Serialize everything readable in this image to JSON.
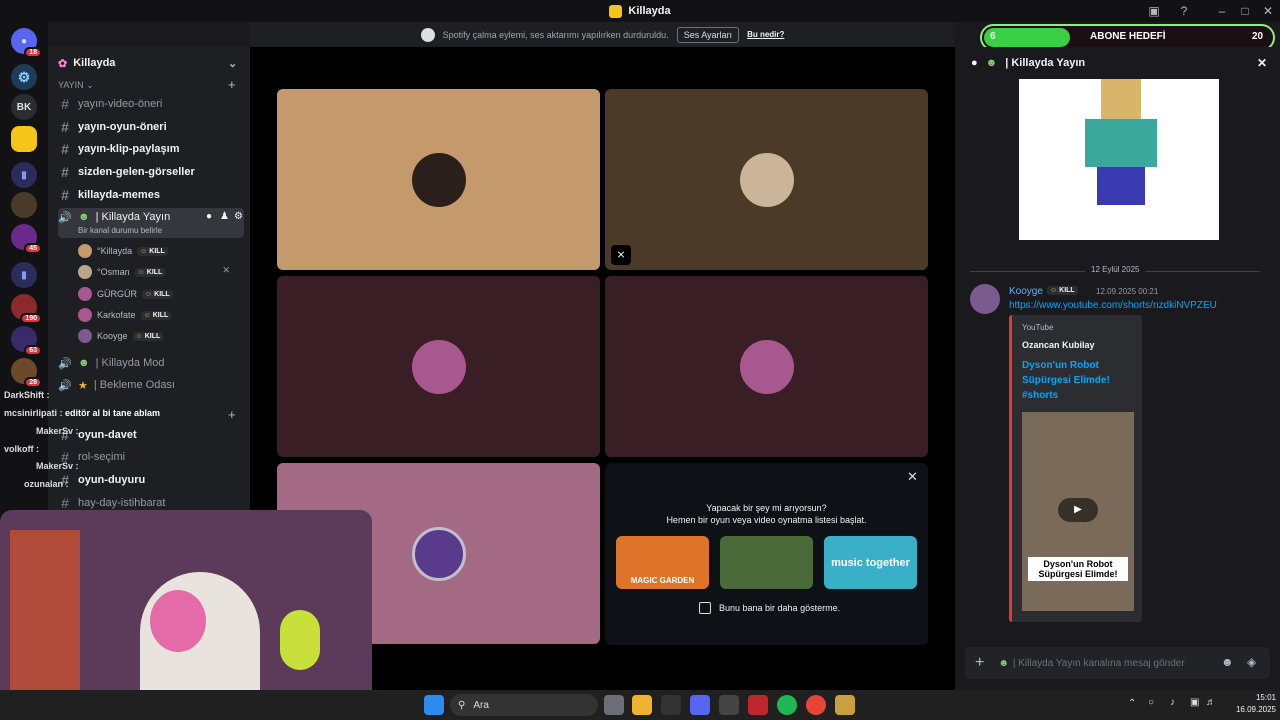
{
  "window": {
    "title": "Killayda"
  },
  "notice": {
    "text": "Spotify çalma eylemi, ses aktarımı yapılırken durduruldu.",
    "button": "Ses Ayarları",
    "link": "Bu nedir?"
  },
  "subgoal": {
    "current": "6",
    "label": "ABONE HEDEFİ",
    "target": "20",
    "progress_fraction": 0.3
  },
  "rail": {
    "servers": [
      {
        "icon": "discord-icon",
        "badge": "18"
      },
      {
        "icon": "gear-icon",
        "badge": ""
      },
      {
        "icon": "text",
        "label": "BK",
        "badge": ""
      },
      {
        "icon": "killayda-server-icon",
        "badge": ""
      },
      {
        "icon": "folder-icon",
        "badge": ""
      },
      {
        "icon": "server-avatar",
        "badge": ""
      },
      {
        "icon": "server-avatar",
        "badge": "45"
      },
      {
        "icon": "folder-icon",
        "badge": ""
      },
      {
        "icon": "server-avatar",
        "badge": "190"
      },
      {
        "icon": "server-avatar",
        "badge": "63"
      },
      {
        "icon": "server-avatar",
        "badge": "28"
      }
    ]
  },
  "server": {
    "name": "Killayda"
  },
  "channels": {
    "category": "YAYIN",
    "text": [
      {
        "name": "yayın-video-öneri",
        "bold": false
      },
      {
        "name": "yayın-oyun-öneri",
        "bold": true
      },
      {
        "name": "yayın-klip-paylaşım",
        "bold": true
      },
      {
        "name": "sizden-gelen-görseller",
        "bold": true
      },
      {
        "name": "killayda-memes",
        "bold": true
      }
    ],
    "voice_active": {
      "name": "| Killayda Yayın",
      "status": "Bir kanal durumu belirle"
    },
    "voice_users": [
      {
        "name": "°Killayda",
        "tag": "KILL"
      },
      {
        "name": "°Osman",
        "tag": "KILL"
      },
      {
        "name": "GÜRGÜR",
        "tag": "KILL"
      },
      {
        "name": "Karkofate",
        "tag": "KILL"
      },
      {
        "name": "Kooyge",
        "tag": "KILL"
      }
    ],
    "voice_other": [
      {
        "name": "| Killayda Mod"
      },
      {
        "name": "| Bekleme Odası"
      }
    ],
    "lower": [
      {
        "name": "oyun-davet"
      },
      {
        "name": "rol-seçimi"
      },
      {
        "name": "oyun-duyuru"
      },
      {
        "name": "hay-day-istihbarat"
      }
    ]
  },
  "stream_chat": [
    {
      "user": "DarkShift :",
      "msg": "",
      "color": "#f2f3f5"
    },
    {
      "user": "mcsinirlipati :",
      "msg": "editör al bi tane ablam",
      "color": "#8df07a"
    },
    {
      "user": "MakerSv :",
      "msg": "",
      "color": "#ff7ad9"
    },
    {
      "user": "volkoff :",
      "msg": "",
      "color": "#ffd84a"
    },
    {
      "user": "MakerSv :",
      "msg": "",
      "color": "#ff7ad9"
    },
    {
      "user": "ozunalan :",
      "msg": "",
      "color": "#7ad8ff"
    }
  ],
  "promo": {
    "title": "Yapacak bir şey mi arıyorsun?",
    "subtitle": "Hemen bir oyun veya video oynatma listesi başlat.",
    "checkbox": "Bunu bana bir daha gösterme.",
    "tiles": [
      {
        "label": "MAGIC GARDEN"
      },
      {
        "label": ""
      },
      {
        "label": "music together"
      }
    ]
  },
  "chat": {
    "header": "| Killayda Yayın",
    "date": "12 Eylül 2025",
    "message": {
      "author": "Kooyge",
      "tag": "KILL",
      "time": "12.09.2025 00:21",
      "link": "https://www.youtube.com/shorts/nzdkiNVPZEU"
    },
    "embed": {
      "provider": "YouTube",
      "channel": "Ozancan Kubilay",
      "title": "Dyson'un Robot Süpürgesi Elimde! #shorts",
      "thumb_caption": "Dyson'un Robot Süpürgesi Elimde!"
    },
    "input_placeholder": "| Killayda Yayın kanalına mesaj gönder"
  },
  "taskbar": {
    "search": "Ara",
    "time": "15:01",
    "date": "16.09.2025"
  },
  "colors": {
    "accent": "#5865f2",
    "tile_tan": "#c49a6c",
    "tile_brown": "#4b3a28",
    "tile_plum": "#3a1e26",
    "tile_pink": "#a46a84"
  }
}
